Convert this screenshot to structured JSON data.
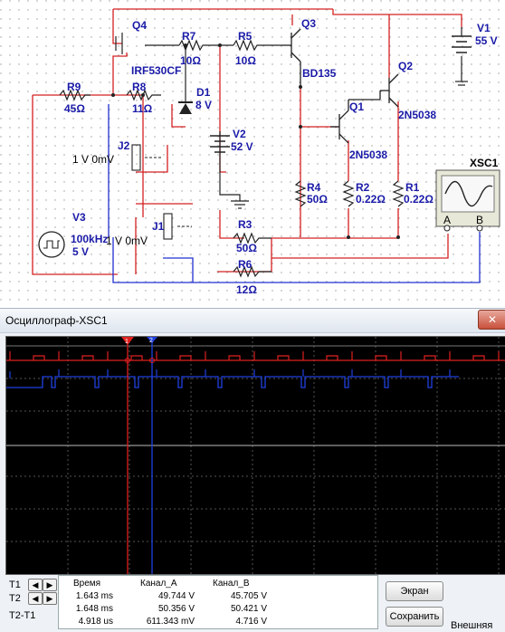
{
  "schematic": {
    "components": {
      "q4": "Q4",
      "irf": "IRF530CF",
      "r7": "R7",
      "r7_val": "10Ω",
      "r5": "R5",
      "r5_val": "10Ω",
      "q3": "Q3",
      "bd135": "BD135",
      "v1": "V1",
      "v1_val": "55 V",
      "q2": "Q2",
      "q2_model": "2N5038",
      "q1": "Q1",
      "q1_model": "2N5038",
      "d1": "D1",
      "d1_val": "8 V",
      "r9": "R9",
      "r9_val": "45Ω",
      "r8": "R8",
      "r8_val": "11Ω",
      "j2": "J2",
      "j2_val": "1 V 0mV",
      "v2": "V2",
      "v2_val": "52 V",
      "r4": "R4",
      "r4_val": "50Ω",
      "r2": "R2",
      "r2_val": "0.22Ω",
      "r1": "R1",
      "r1_val": "0.22Ω",
      "xsc1": "XSC1",
      "v3": "V3",
      "v3_freq": "100kHz",
      "v3_val": "5 V",
      "j1": "J1",
      "j1_val": "1 V 0mV",
      "r3": "R3",
      "r3_val": "50Ω",
      "r6": "R6",
      "r6_val": "12Ω",
      "scope_a": "A",
      "scope_b": "B"
    }
  },
  "oscilloscope": {
    "title": "Осциллограф-XSC1",
    "close_glyph": "✕",
    "cursor1_label": "1",
    "cursor2_label": "2",
    "channel_a_color": "#e02020",
    "channel_b_color": "#2040e0",
    "headers": {
      "time": "Время",
      "ch_a": "Канал_A",
      "ch_b": "Канал_B"
    },
    "rows": [
      {
        "label": "T1",
        "time": "1.643 ms",
        "ch_a": "49.744 V",
        "ch_b": "45.705 V"
      },
      {
        "label": "T2",
        "time": "1.648 ms",
        "ch_a": "50.356 V",
        "ch_b": "50.421 V"
      },
      {
        "label": "T2-T1",
        "time": "4.918 us",
        "ch_a": "611.343 mV",
        "ch_b": "4.716 V"
      }
    ],
    "buttons": {
      "screen": "Экран",
      "save": "Сохранить"
    },
    "trigger_label": "Внешняя"
  }
}
